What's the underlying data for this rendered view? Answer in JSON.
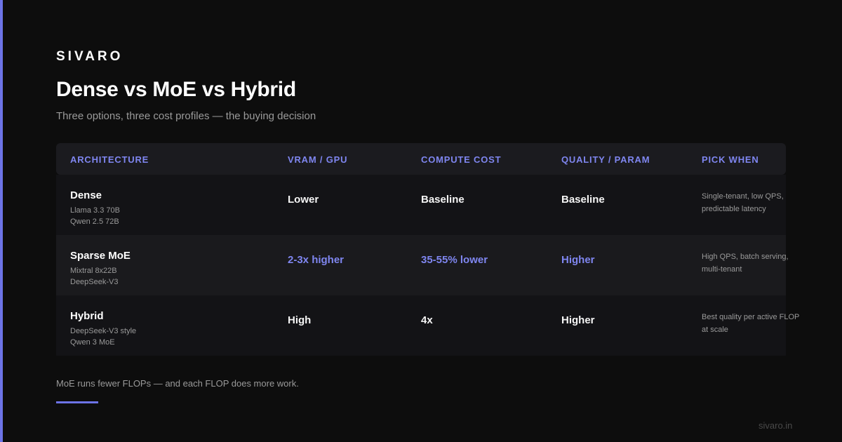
{
  "brand": "SIVARO",
  "title": "Dense vs MoE vs Hybrid",
  "subtitle": "Three options, three cost profiles — the buying decision",
  "colors": {
    "background": "#0d0d0d",
    "accent": "#7f86f0",
    "header_bg": "#1b1b1f",
    "muted_text": "#9a9a9a"
  },
  "table": {
    "headers": [
      "ARCHITECTURE",
      "VRAM / GPU",
      "COMPUTE COST",
      "QUALITY / PARAM",
      "PICK WHEN"
    ],
    "rows": [
      {
        "name": "Dense",
        "models": [
          "Llama 3.3 70B",
          "Qwen 2.5 72B"
        ],
        "vram": "Lower",
        "compute": "Baseline",
        "quality": "Baseline",
        "pick": "Single-tenant, low QPS, predictable latency",
        "highlight": false
      },
      {
        "name": "Sparse MoE",
        "models": [
          "Mixtral 8x22B",
          "DeepSeek-V3"
        ],
        "vram": "2-3x higher",
        "compute": "35-55% lower",
        "quality": "Higher",
        "pick": "High QPS, batch serving, multi-tenant",
        "highlight": true
      },
      {
        "name": "Hybrid",
        "models": [
          "DeepSeek-V3 style",
          "Qwen 3 MoE"
        ],
        "vram": "High",
        "compute": "4x",
        "quality": "Higher",
        "pick": "Best quality per active FLOP at scale",
        "highlight": false
      }
    ]
  },
  "footnote": "MoE runs fewer FLOPs — and each FLOP does more work.",
  "site": "sivaro.in"
}
